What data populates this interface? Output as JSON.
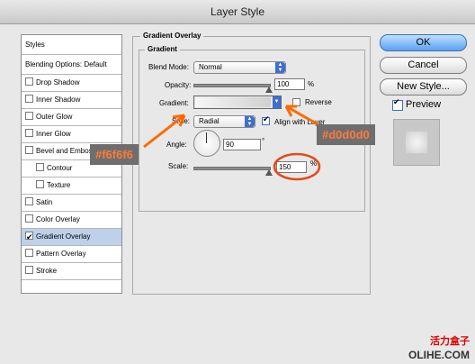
{
  "window": {
    "title": "Layer Style"
  },
  "sidebar": {
    "header": "Styles",
    "blending": "Blending Options: Default",
    "items": [
      {
        "label": "Drop Shadow",
        "checked": false,
        "indent": false
      },
      {
        "label": "Inner Shadow",
        "checked": false,
        "indent": false
      },
      {
        "label": "Outer Glow",
        "checked": false,
        "indent": false
      },
      {
        "label": "Inner Glow",
        "checked": false,
        "indent": false
      },
      {
        "label": "Bevel and Emboss",
        "checked": false,
        "indent": false
      },
      {
        "label": "Contour",
        "checked": false,
        "indent": true
      },
      {
        "label": "Texture",
        "checked": false,
        "indent": true
      },
      {
        "label": "Satin",
        "checked": false,
        "indent": false
      },
      {
        "label": "Color Overlay",
        "checked": false,
        "indent": false
      },
      {
        "label": "Gradient Overlay",
        "checked": true,
        "indent": false,
        "selected": true
      },
      {
        "label": "Pattern Overlay",
        "checked": false,
        "indent": false
      },
      {
        "label": "Stroke",
        "checked": false,
        "indent": false
      }
    ]
  },
  "panel": {
    "title": "Gradient Overlay",
    "group_title": "Gradient",
    "blend_mode_label": "Blend Mode:",
    "blend_mode_value": "Normal",
    "opacity_label": "Opacity:",
    "opacity_value": "100",
    "opacity_unit": "%",
    "gradient_label": "Gradient:",
    "reverse_label": "Reverse",
    "style_label": "Style:",
    "style_value": "Radial",
    "align_label": "Align with Layer",
    "angle_label": "Angle:",
    "angle_value": "90",
    "angle_unit": "°",
    "scale_label": "Scale:",
    "scale_value": "150",
    "scale_unit": "%"
  },
  "buttons": {
    "ok": "OK",
    "cancel": "Cancel",
    "new_style": "New Style...",
    "preview": "Preview"
  },
  "annotations": {
    "left": "#f6f6f6",
    "right": "#d0d0d0"
  },
  "watermark": {
    "line1": "活力盒子",
    "line2": "OLIHE.COM"
  },
  "colors": {
    "gradient_start": "#f6f6f6",
    "gradient_end": "#d0d0d0",
    "annotation_bg": "#6e6e6e",
    "annotation_text": "#ff7a3a",
    "arrow": "#ff6a00",
    "highlight_circle": "#e34a1a",
    "selection": "#bdd2ea"
  }
}
